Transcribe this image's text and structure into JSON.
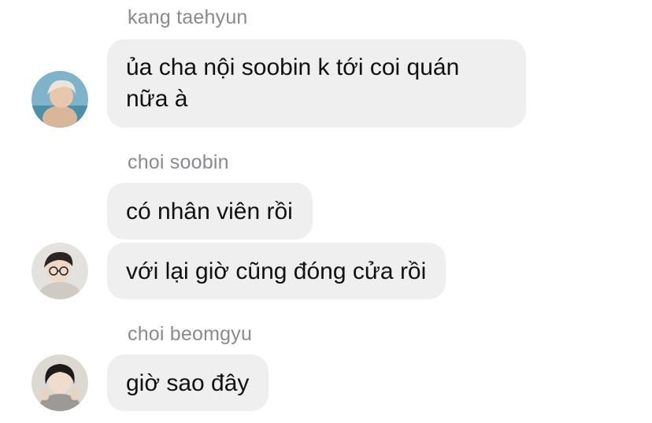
{
  "messages": [
    {
      "sender": "kang taehyun",
      "texts": [
        "ủa cha nội soobin k tới coi quán nữa à"
      ]
    },
    {
      "sender": "choi soobin",
      "texts": [
        "có nhân viên rồi",
        "với lại giờ cũng đóng cửa rồi"
      ]
    },
    {
      "sender": "choi beomgyu",
      "texts": [
        "giờ sao đây"
      ]
    }
  ]
}
